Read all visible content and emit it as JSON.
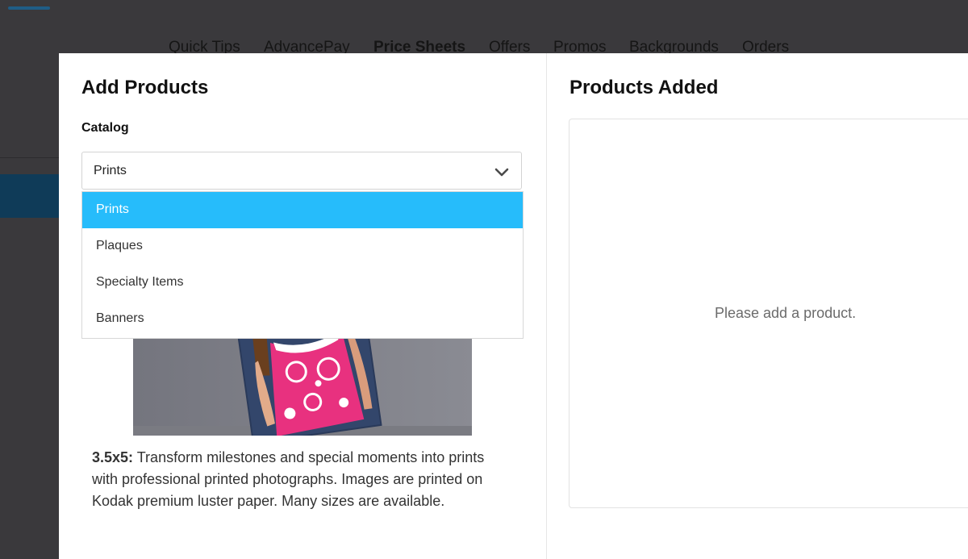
{
  "background_nav": {
    "items": [
      {
        "label": "Quick Tips",
        "active": false
      },
      {
        "label": "AdvancePay",
        "active": false
      },
      {
        "label": "Price Sheets",
        "active": true
      },
      {
        "label": "Offers",
        "active": false
      },
      {
        "label": "Promos",
        "active": false
      },
      {
        "label": "Backgrounds",
        "active": false
      },
      {
        "label": "Orders",
        "active": false
      }
    ]
  },
  "add_products": {
    "title": "Add Products",
    "catalog_label": "Catalog",
    "catalog_selected": "Prints",
    "catalog_options": [
      "Prints",
      "Plaques",
      "Specialty Items",
      "Banners"
    ],
    "product": {
      "size": "3.5x5:",
      "description": "Transform milestones and special moments into prints with professional printed photographs. Images are printed on Kodak premium luster paper. Many sizes are available."
    }
  },
  "products_added": {
    "title": "Products Added",
    "empty_message": "Please add a product."
  },
  "colors": {
    "accent": "#26bcfb",
    "overlay": "#3a393c"
  },
  "icons": {
    "select_toggle": "chevron-down-icon"
  }
}
